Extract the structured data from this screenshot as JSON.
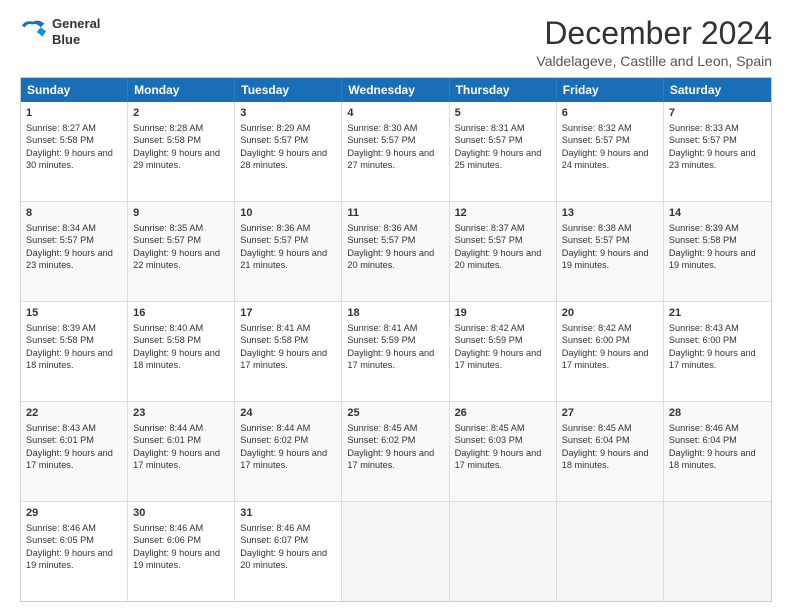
{
  "logo": {
    "line1": "General",
    "line2": "Blue"
  },
  "title": "December 2024",
  "subtitle": "Valdelageve, Castille and Leon, Spain",
  "days": [
    "Sunday",
    "Monday",
    "Tuesday",
    "Wednesday",
    "Thursday",
    "Friday",
    "Saturday"
  ],
  "weeks": [
    [
      {
        "num": "1",
        "rise": "8:27 AM",
        "set": "5:58 PM",
        "daylight": "9 hours and 30 minutes."
      },
      {
        "num": "2",
        "rise": "8:28 AM",
        "set": "5:58 PM",
        "daylight": "9 hours and 29 minutes."
      },
      {
        "num": "3",
        "rise": "8:29 AM",
        "set": "5:57 PM",
        "daylight": "9 hours and 28 minutes."
      },
      {
        "num": "4",
        "rise": "8:30 AM",
        "set": "5:57 PM",
        "daylight": "9 hours and 27 minutes."
      },
      {
        "num": "5",
        "rise": "8:31 AM",
        "set": "5:57 PM",
        "daylight": "9 hours and 25 minutes."
      },
      {
        "num": "6",
        "rise": "8:32 AM",
        "set": "5:57 PM",
        "daylight": "9 hours and 24 minutes."
      },
      {
        "num": "7",
        "rise": "8:33 AM",
        "set": "5:57 PM",
        "daylight": "9 hours and 23 minutes."
      }
    ],
    [
      {
        "num": "8",
        "rise": "8:34 AM",
        "set": "5:57 PM",
        "daylight": "9 hours and 23 minutes."
      },
      {
        "num": "9",
        "rise": "8:35 AM",
        "set": "5:57 PM",
        "daylight": "9 hours and 22 minutes."
      },
      {
        "num": "10",
        "rise": "8:36 AM",
        "set": "5:57 PM",
        "daylight": "9 hours and 21 minutes."
      },
      {
        "num": "11",
        "rise": "8:36 AM",
        "set": "5:57 PM",
        "daylight": "9 hours and 20 minutes."
      },
      {
        "num": "12",
        "rise": "8:37 AM",
        "set": "5:57 PM",
        "daylight": "9 hours and 20 minutes."
      },
      {
        "num": "13",
        "rise": "8:38 AM",
        "set": "5:57 PM",
        "daylight": "9 hours and 19 minutes."
      },
      {
        "num": "14",
        "rise": "8:39 AM",
        "set": "5:58 PM",
        "daylight": "9 hours and 19 minutes."
      }
    ],
    [
      {
        "num": "15",
        "rise": "8:39 AM",
        "set": "5:58 PM",
        "daylight": "9 hours and 18 minutes."
      },
      {
        "num": "16",
        "rise": "8:40 AM",
        "set": "5:58 PM",
        "daylight": "9 hours and 18 minutes."
      },
      {
        "num": "17",
        "rise": "8:41 AM",
        "set": "5:58 PM",
        "daylight": "9 hours and 17 minutes."
      },
      {
        "num": "18",
        "rise": "8:41 AM",
        "set": "5:59 PM",
        "daylight": "9 hours and 17 minutes."
      },
      {
        "num": "19",
        "rise": "8:42 AM",
        "set": "5:59 PM",
        "daylight": "9 hours and 17 minutes."
      },
      {
        "num": "20",
        "rise": "8:42 AM",
        "set": "6:00 PM",
        "daylight": "9 hours and 17 minutes."
      },
      {
        "num": "21",
        "rise": "8:43 AM",
        "set": "6:00 PM",
        "daylight": "9 hours and 17 minutes."
      }
    ],
    [
      {
        "num": "22",
        "rise": "8:43 AM",
        "set": "6:01 PM",
        "daylight": "9 hours and 17 minutes."
      },
      {
        "num": "23",
        "rise": "8:44 AM",
        "set": "6:01 PM",
        "daylight": "9 hours and 17 minutes."
      },
      {
        "num": "24",
        "rise": "8:44 AM",
        "set": "6:02 PM",
        "daylight": "9 hours and 17 minutes."
      },
      {
        "num": "25",
        "rise": "8:45 AM",
        "set": "6:02 PM",
        "daylight": "9 hours and 17 minutes."
      },
      {
        "num": "26",
        "rise": "8:45 AM",
        "set": "6:03 PM",
        "daylight": "9 hours and 17 minutes."
      },
      {
        "num": "27",
        "rise": "8:45 AM",
        "set": "6:04 PM",
        "daylight": "9 hours and 18 minutes."
      },
      {
        "num": "28",
        "rise": "8:46 AM",
        "set": "6:04 PM",
        "daylight": "9 hours and 18 minutes."
      }
    ],
    [
      {
        "num": "29",
        "rise": "8:46 AM",
        "set": "6:05 PM",
        "daylight": "9 hours and 19 minutes."
      },
      {
        "num": "30",
        "rise": "8:46 AM",
        "set": "6:06 PM",
        "daylight": "9 hours and 19 minutes."
      },
      {
        "num": "31",
        "rise": "8:46 AM",
        "set": "6:07 PM",
        "daylight": "9 hours and 20 minutes."
      },
      null,
      null,
      null,
      null
    ]
  ]
}
